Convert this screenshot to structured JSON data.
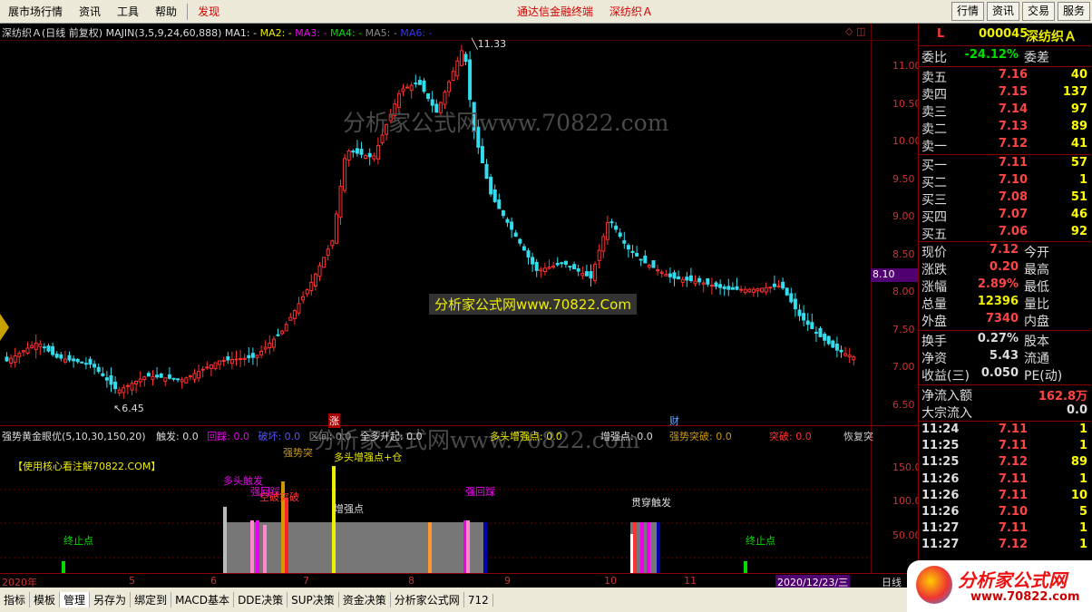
{
  "menubar": {
    "items": [
      "展市场行情",
      "资讯",
      "工具",
      "帮助"
    ],
    "fx": "发现",
    "center": [
      "通达信金融终端",
      "深纺织Ａ"
    ],
    "right_buttons": [
      "行情",
      "资讯",
      "交易",
      "服务"
    ]
  },
  "chart": {
    "header": {
      "name": "深纺织Ａ(日线 前复权)",
      "ind": "MAJIN(3,5,9,24,60,888)",
      "ma1": "MA1: -",
      "ma2": "MA2: -",
      "ma3": "MA3: -",
      "ma4": "MA4: -",
      "ma5": "MA5: -",
      "ma6": "MA6: -"
    },
    "high_label": "11.33",
    "low_label": "6.45",
    "price_ticks": [
      "11.00",
      "10.50",
      "10.00",
      "9.50",
      "9.00",
      "8.50",
      "8.00",
      "7.50",
      "7.00",
      "6.50"
    ],
    "cur_price_tag": "8.10",
    "watermarks": [
      "分析家公式网www.70822.com",
      "分析家公式网www.70822.com"
    ],
    "banner": "分析家公式网www.70822.Com",
    "mark_zhang": "涨",
    "mark_cai": "财",
    "sub": {
      "title": "强势黄金眼优(5,10,30,150,20)",
      "touch": "触发: 0.0",
      "huicai": "回踩: 0.0",
      "poshang": "破坏: 0.0",
      "qujian": "区间: 0.0",
      "allbuy": "全多升起: 0.0",
      "zengqiang": "多头增强点: 0.0",
      "zengqiang2": "增强点: 0.0",
      "qstp": "强势突破: 0.0",
      "tupo": "突破: 0.0",
      "huifu": "恢复突",
      "note": "【使用核心看注解70822.COM】",
      "labels": [
        "多头触发",
        "强势突",
        "多头增强点+仓",
        "强回踩",
        "空破突破",
        "增强点",
        "强回踩",
        "贯穿触发",
        "终止点",
        "终止点"
      ],
      "ticks": [
        "150.00",
        "100.00",
        "50.00"
      ]
    },
    "time_axis": [
      "2020年",
      "5",
      "6",
      "7",
      "8",
      "9",
      "10",
      "11",
      "2020/12/23/三",
      "日线"
    ]
  },
  "quote": {
    "code": "000045",
    "name": "深纺织Ａ",
    "flag": "L",
    "weibi_label": "委比",
    "weibi": "-24.12%",
    "weicha_label": "委差",
    "sell": [
      {
        "label": "卖五",
        "price": "7.16",
        "vol": "40"
      },
      {
        "label": "卖四",
        "price": "7.15",
        "vol": "137"
      },
      {
        "label": "卖三",
        "price": "7.14",
        "vol": "97"
      },
      {
        "label": "卖二",
        "price": "7.13",
        "vol": "89"
      },
      {
        "label": "卖一",
        "price": "7.12",
        "vol": "41"
      }
    ],
    "buy": [
      {
        "label": "买一",
        "price": "7.11",
        "vol": "57"
      },
      {
        "label": "买二",
        "price": "7.10",
        "vol": "1"
      },
      {
        "label": "买三",
        "price": "7.08",
        "vol": "51"
      },
      {
        "label": "买四",
        "price": "7.07",
        "vol": "46"
      },
      {
        "label": "买五",
        "price": "7.06",
        "vol": "92"
      }
    ],
    "stats": [
      {
        "l": "现价",
        "v": "7.12",
        "l2": "今开"
      },
      {
        "l": "涨跌",
        "v": "0.20",
        "l2": "最高"
      },
      {
        "l": "涨幅",
        "v": "2.89%",
        "l2": "最低"
      },
      {
        "l": "总量",
        "v": "12396",
        "l2": "量比"
      },
      {
        "l": "外盘",
        "v": "7340",
        "l2": "内盘"
      }
    ],
    "stats2": [
      {
        "l": "换手",
        "v": "0.27%",
        "l2": "股本"
      },
      {
        "l": "净资",
        "v": "5.43",
        "l2": "流通"
      },
      {
        "l": "收益(三)",
        "v": "0.050",
        "l2": "PE(动)"
      }
    ],
    "flow": [
      {
        "l": "净流入额",
        "v": "162.8万"
      },
      {
        "l": "大宗流入",
        "v": "0.0"
      }
    ],
    "ticks": [
      {
        "t": "11:24",
        "p": "7.11",
        "v": "1"
      },
      {
        "t": "11:25",
        "p": "7.11",
        "v": "1"
      },
      {
        "t": "11:25",
        "p": "7.12",
        "v": "89"
      },
      {
        "t": "11:26",
        "p": "7.11",
        "v": "1"
      },
      {
        "t": "11:26",
        "p": "7.11",
        "v": "10"
      },
      {
        "t": "11:26",
        "p": "7.10",
        "v": "5"
      },
      {
        "t": "11:27",
        "p": "7.11",
        "v": "1"
      },
      {
        "t": "11:27",
        "p": "7.12",
        "v": "1"
      }
    ]
  },
  "bottom": {
    "buttons": [
      "指标",
      "模板",
      "管理",
      "另存为",
      "绑定到",
      "MACD基本",
      "DDE决策",
      "SUP决策",
      "资金决策",
      "分析家公式网",
      "712"
    ],
    "logo": "分析家公式网",
    "logo_url": "www.70822.com"
  }
}
